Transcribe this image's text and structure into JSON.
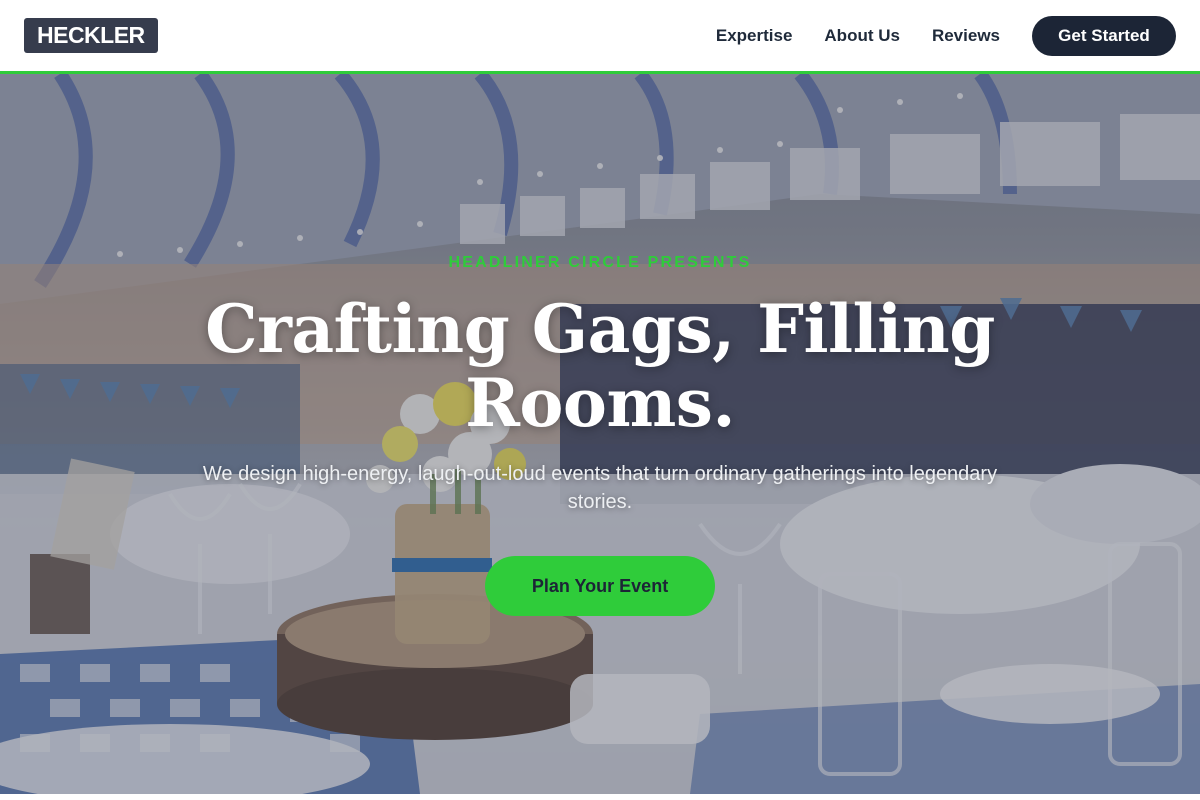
{
  "brand": {
    "logo_text": "HECKLER"
  },
  "nav": {
    "links": [
      {
        "label": "Expertise"
      },
      {
        "label": "About Us"
      },
      {
        "label": "Reviews"
      }
    ],
    "cta_label": "Get Started"
  },
  "hero": {
    "eyebrow": "HEADLINER CIRCLE PRESENTS",
    "headline": "Crafting Gags, Filling Rooms.",
    "subhead": "We design high-energy, laugh-out-loud events that turn ordinary gatherings into legendary stories.",
    "cta_label": "Plan Your Event"
  },
  "colors": {
    "accent": "#2fcc3a",
    "navy": "#1c2536",
    "logo_bg": "#363c4d"
  }
}
